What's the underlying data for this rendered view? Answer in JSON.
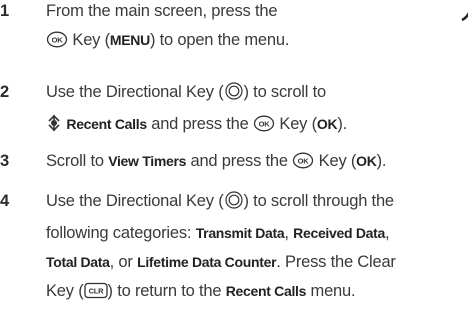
{
  "steps": [
    {
      "num": "1",
      "line1": "From the main screen, press the",
      "line2_key_label": "Key (",
      "line2_bold": "MENU",
      "line2_end": ") to open the menu."
    },
    {
      "num": "2",
      "line1_pre": "Use the Directional Key (",
      "line1_post": ") to scroll to",
      "line2_bold": "Recent Calls",
      "line2_mid": "and press the",
      "line2_key_label": "Key (",
      "line2_bold2": "OK",
      "line2_end": ")."
    },
    {
      "num": "3",
      "pre": "Scroll to ",
      "bold1": "View Timers",
      "mid": " and press the",
      "key_label": "Key (",
      "bold2": "OK",
      "end": ")."
    },
    {
      "num": "4",
      "line1_pre": "Use the Directional Key (",
      "line1_post": ") to scroll through the",
      "line2_pre": "following categories: ",
      "b1": "Transmit Data",
      "sep1": ", ",
      "b2": "Received Data",
      "sep2": ",",
      "b3": "Total Data",
      "sep3": ", or ",
      "b4": "Lifetime Data Counter",
      "line3_end": ". Press the Clear",
      "line4_pre": "Key (",
      "line4_mid": ") to return to the ",
      "b5": "Recent Calls",
      "line4_end": " menu."
    }
  ],
  "icons": {
    "ok_key": "ok-key-icon",
    "nav_key": "directional-key-icon",
    "clr_key": "clr-key-icon",
    "recent_calls": "recent-calls-icon"
  },
  "icon_text": {
    "ok": "OK",
    "clr": "CLR"
  }
}
